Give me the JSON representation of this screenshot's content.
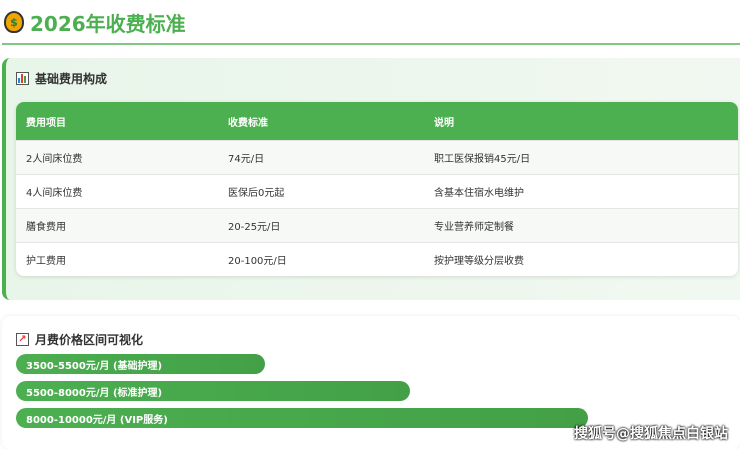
{
  "header": {
    "title": "2026年收费标准",
    "icon": "money-bag-icon"
  },
  "basic": {
    "title": "基础费用构成",
    "icon": "bar-chart-icon",
    "columns": [
      "费用项目",
      "收费标准",
      "说明"
    ],
    "rows": [
      [
        "2人间床位费",
        "74元/日",
        "职工医保报销45元/日"
      ],
      [
        "4人间床位费",
        "医保后0元起",
        "含基本住宿水电维护"
      ],
      [
        "膳食费用",
        "20-25元/日",
        "专业营养师定制餐"
      ],
      [
        "护工费用",
        "20-100元/日",
        "按护理等级分层收费"
      ]
    ]
  },
  "monthly": {
    "title": "月费价格区间可视化",
    "icon": "line-chart-icon",
    "bars": [
      {
        "label": "3500-5500元/月 (基础护理)",
        "fill_percent": 35
      },
      {
        "label": "5500-8000元/月 (标准护理)",
        "fill_percent": 55.5
      },
      {
        "label": "8000-10000元/月 (VIP服务)",
        "fill_percent": 80.5
      }
    ]
  },
  "watermark": "搜狐号@搜狐焦点白银站"
}
